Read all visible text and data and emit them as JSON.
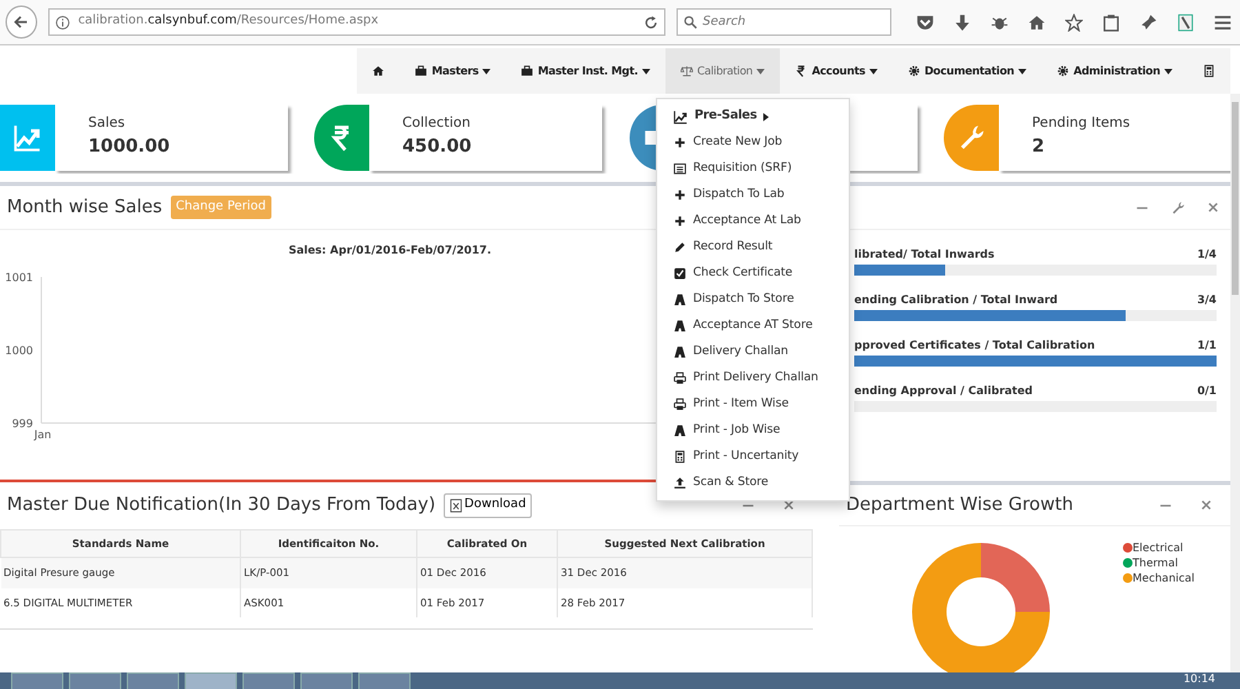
{
  "browser": {
    "url": "calibration.**calsynbuf.com**/Resources/Home.aspx",
    "search_placeholder": "Search"
  },
  "nav": [
    {
      "kind": "icon",
      "selected": false
    },
    {
      "kind": "menu",
      "label": "Masters",
      "selected": false
    },
    {
      "kind": "menu",
      "label": "Master Inst. Mgt.",
      "selected": false
    },
    {
      "kind": "menu",
      "label": "Calibration",
      "selected": true
    },
    {
      "kind": "menu",
      "label": "Accounts",
      "selected": false
    },
    {
      "kind": "menu",
      "label": "Documentation",
      "selected": false
    },
    {
      "kind": "menu",
      "label": "Administration",
      "selected": false
    },
    {
      "kind": "icon",
      "selected": false
    }
  ],
  "stats": [
    {
      "label": "Sales",
      "value": "1000.00",
      "color": "#00c0ef"
    },
    {
      "label": "Collection",
      "value": "450.00",
      "color": "#00a65a"
    },
    {
      "color": "#3c8dbc"
    },
    {
      "label": "Pending Items",
      "value": "2",
      "color": "#f39c12"
    }
  ],
  "sales_panel": {
    "title": "Month wise Sales",
    "button": "Change Period",
    "chart_data": {
      "type": "line",
      "title": "Sales: Apr/01/2016-Feb/07/2017.",
      "categories": [
        "Jan"
      ],
      "ylim": [
        999,
        1001
      ],
      "yticks": [
        999,
        1000,
        1001
      ]
    }
  },
  "progress_panel": {
    "items": [
      {
        "label": "librated/ Total Inwards",
        "reading": "1/4",
        "level": 0.25
      },
      {
        "label": "ending Calibration / Total Inward",
        "reading": "3/4",
        "level": 0.75
      },
      {
        "label": "pproved Certificates / Total Calibration",
        "reading": "1/1",
        "level": 1
      },
      {
        "label": "ending Approval / Calibrated",
        "reading": "0/1",
        "level": 0
      }
    ]
  },
  "menu": {
    "items": [
      {
        "kind": "submenu",
        "label": "Pre-Sales"
      },
      {
        "kind": "item",
        "label": "Create New Job"
      },
      {
        "kind": "item",
        "label": "Requisition (SRF)"
      },
      {
        "kind": "item",
        "label": "Dispatch To Lab"
      },
      {
        "kind": "item",
        "label": "Acceptance At Lab"
      },
      {
        "kind": "item",
        "label": "Record Result"
      },
      {
        "kind": "item",
        "label": "Check Certificate"
      },
      {
        "kind": "item",
        "label": "Dispatch To Store"
      },
      {
        "kind": "item",
        "label": "Acceptance AT Store"
      },
      {
        "kind": "item",
        "label": "Delivery Challan"
      },
      {
        "kind": "item",
        "label": "Print Delivery Challan"
      },
      {
        "kind": "item",
        "label": "Print - Item Wise"
      },
      {
        "kind": "item",
        "label": "Print - Job Wise"
      },
      {
        "kind": "item",
        "label": "Print - Uncertanity"
      },
      {
        "kind": "item",
        "label": "Scan & Store"
      }
    ]
  },
  "due_panel": {
    "title": "Master Due Notification(In 30 Days From Today)",
    "button": "Download",
    "table": {
      "columns": [
        "Standards Name",
        "Identificaiton No.",
        "Calibrated On",
        "Suggested Next Calibration"
      ],
      "rows": [
        [
          "Digital Presure gauge",
          "LK/P-001",
          "01 Dec 2016",
          "31 Dec 2016"
        ],
        [
          "6.5 DIGITAL MULTIMETER",
          "ASK001",
          "01 Feb 2017",
          "28 Feb 2017"
        ]
      ]
    }
  },
  "dept_panel": {
    "title": "Department Wise Growth",
    "legend": [
      {
        "label": "Electrical",
        "color": "#dd4b39"
      },
      {
        "label": "Thermal",
        "color": "#00a65a"
      },
      {
        "label": "Mechanical",
        "color": "#f39c12"
      }
    ]
  },
  "taskbar": {
    "clock": "10:14"
  }
}
